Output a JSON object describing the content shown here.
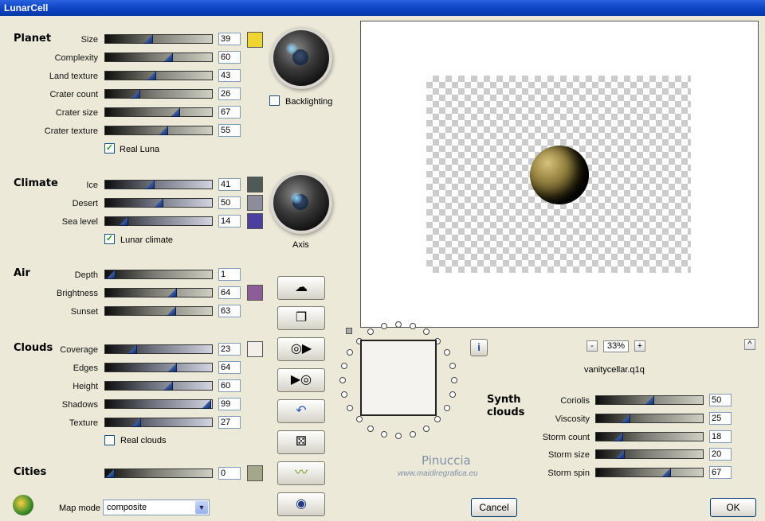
{
  "window": {
    "title": "LunarCell"
  },
  "planet": {
    "title": "Planet",
    "sliders": [
      {
        "label": "Size",
        "value": "39",
        "frac": 0.39
      },
      {
        "label": "Complexity",
        "value": "60",
        "frac": 0.6
      },
      {
        "label": "Land texture",
        "value": "43",
        "frac": 0.43
      },
      {
        "label": "Crater count",
        "value": "26",
        "frac": 0.26
      },
      {
        "label": "Crater size",
        "value": "67",
        "frac": 0.67
      },
      {
        "label": "Crater texture",
        "value": "55",
        "frac": 0.55
      }
    ],
    "swatch_color": "#f0d531",
    "real_luna_label": "Real Luna",
    "real_luna_checked": true,
    "backlighting_label": "Backlighting",
    "backlighting_checked": false
  },
  "climate": {
    "title": "Climate",
    "sliders": [
      {
        "label": "Ice",
        "value": "41",
        "frac": 0.41
      },
      {
        "label": "Desert",
        "value": "50",
        "frac": 0.5
      },
      {
        "label": "Sea level",
        "value": "14",
        "frac": 0.14
      }
    ],
    "swatch_colors": [
      "#4d5a55",
      "#8d8c9a",
      "#4b3fa0"
    ],
    "lunar_climate_label": "Lunar climate",
    "lunar_climate_checked": true,
    "axis_label": "Axis"
  },
  "air": {
    "title": "Air",
    "sliders": [
      {
        "label": "Depth",
        "value": "1",
        "frac": 0.01
      },
      {
        "label": "Brightness",
        "value": "64",
        "frac": 0.64
      },
      {
        "label": "Sunset",
        "value": "63",
        "frac": 0.63
      }
    ],
    "swatch_color": "#8b5e96"
  },
  "clouds": {
    "title": "Clouds",
    "sliders": [
      {
        "label": "Coverage",
        "value": "23",
        "frac": 0.23
      },
      {
        "label": "Edges",
        "value": "64",
        "frac": 0.64
      },
      {
        "label": "Height",
        "value": "60",
        "frac": 0.6
      },
      {
        "label": "Shadows",
        "value": "99",
        "frac": 0.99
      },
      {
        "label": "Texture",
        "value": "27",
        "frac": 0.27
      }
    ],
    "swatch_color": "#f2eeea",
    "real_clouds_label": "Real clouds",
    "real_clouds_checked": false
  },
  "cities": {
    "title": "Cities",
    "value": "0",
    "frac": 0.0,
    "swatch_color": "#a4a78a"
  },
  "map_mode": {
    "label": "Map mode",
    "selected": "composite"
  },
  "tool_buttons": [
    {
      "icon": "cloud-icon"
    },
    {
      "icon": "copy-icon"
    },
    {
      "icon": "disc-arrow-icon"
    },
    {
      "icon": "play-disc-icon"
    },
    {
      "icon": "undo-icon"
    },
    {
      "icon": "dice-icon"
    },
    {
      "icon": "wave-icon"
    },
    {
      "icon": "ring-icon"
    }
  ],
  "preview": {
    "zoom": "33%",
    "filename": "vanitycellar.q1q",
    "zoom_minus": "-",
    "zoom_plus": "+",
    "info": "i",
    "up": "^"
  },
  "synth_clouds": {
    "title": "Synth clouds",
    "sliders": [
      {
        "label": "Coriolis",
        "value": "50",
        "frac": 0.5
      },
      {
        "label": "Viscosity",
        "value": "25",
        "frac": 0.25
      },
      {
        "label": "Storm count",
        "value": "18",
        "frac": 0.18
      },
      {
        "label": "Storm size",
        "value": "20",
        "frac": 0.2
      },
      {
        "label": "Storm spin",
        "value": "67",
        "frac": 0.67
      }
    ]
  },
  "watermark": {
    "name": "Pinuccia",
    "url": "www.maidiregrafica.eu"
  },
  "buttons": {
    "cancel": "Cancel",
    "ok": "OK"
  }
}
